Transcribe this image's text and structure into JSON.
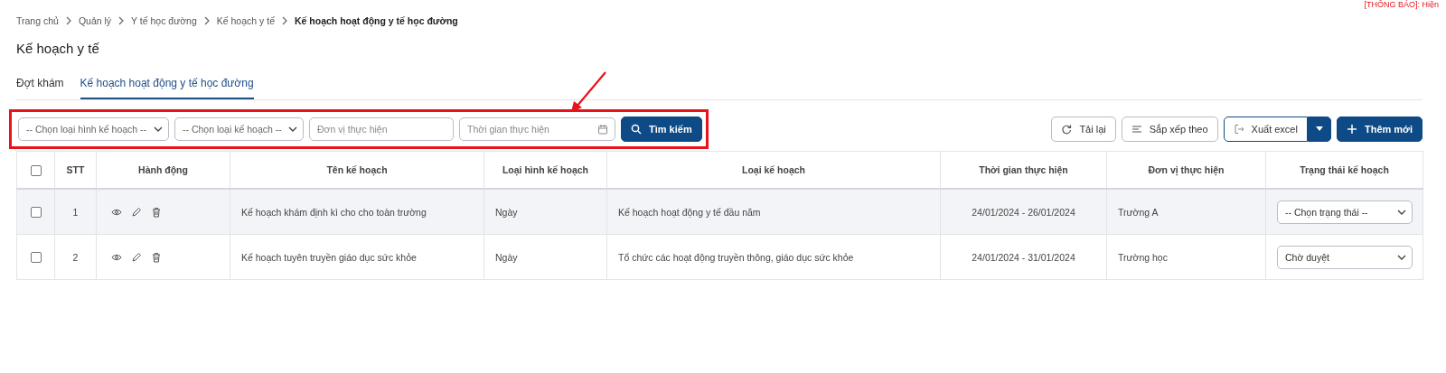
{
  "notice": {
    "text": "[THÔNG BÁO]: Hiện"
  },
  "breadcrumb": [
    {
      "label": "Trang chủ",
      "current": false
    },
    {
      "label": "Quản lý",
      "current": false
    },
    {
      "label": "Y tế học đường",
      "current": false
    },
    {
      "label": "Kế hoạch y tế",
      "current": false
    },
    {
      "label": "Kế hoạch hoạt động y tế học đường",
      "current": true
    }
  ],
  "page_title": "Kế hoạch y tế",
  "tabs": [
    {
      "label": "Đợt khám",
      "selected": false
    },
    {
      "label": "Kế hoạch hoạt động y tế học đường",
      "selected": true
    }
  ],
  "filters": [
    {
      "kind": "select",
      "value": "-- Chọn loại hình kế hoạch --"
    },
    {
      "kind": "select",
      "value": "-- Chọn loại kế hoạch --"
    },
    {
      "kind": "text",
      "placeholder": "Đơn vị thực hiện"
    },
    {
      "kind": "date",
      "placeholder": "Thời gian thực hiện"
    }
  ],
  "search_button": "Tìm kiếm",
  "annotation": {
    "highlight_box": true,
    "arrow": true
  },
  "toolbar": [
    {
      "kind": "reload",
      "label": "Tải lại"
    },
    {
      "kind": "sort",
      "label": "Sắp xếp theo"
    },
    {
      "kind": "export",
      "label": "Xuất excel"
    },
    {
      "kind": "add",
      "label": "Thêm mới"
    }
  ],
  "table": {
    "header_checked": false,
    "columns": [
      "STT",
      "Hành động",
      "Tên kế hoạch",
      "Loại hình kế hoạch",
      "Loại kế hoạch",
      "Thời gian thực hiện",
      "Đơn vị thực hiện",
      "Trạng thái kế hoạch"
    ],
    "rows": [
      {
        "checked": false,
        "highlighted": true,
        "stt": "1",
        "name": "Kế hoạch khám định kì cho cho toàn trường",
        "form": "Ngày",
        "type": "Kế hoạch hoạt động y tế đầu năm",
        "time": "24/01/2024 - 26/01/2024",
        "unit": "Trường A",
        "status": "-- Chọn trạng thái --"
      },
      {
        "checked": false,
        "highlighted": false,
        "stt": "2",
        "name": "Kế hoạch tuyên truyền giáo dục sức khỏe",
        "form": "Ngày",
        "type": "Tổ chức các hoạt động truyền thông, giáo dục sức khỏe",
        "time": "24/01/2024 - 31/01/2024",
        "unit": "Trường học",
        "status": "Chờ duyệt"
      }
    ]
  }
}
